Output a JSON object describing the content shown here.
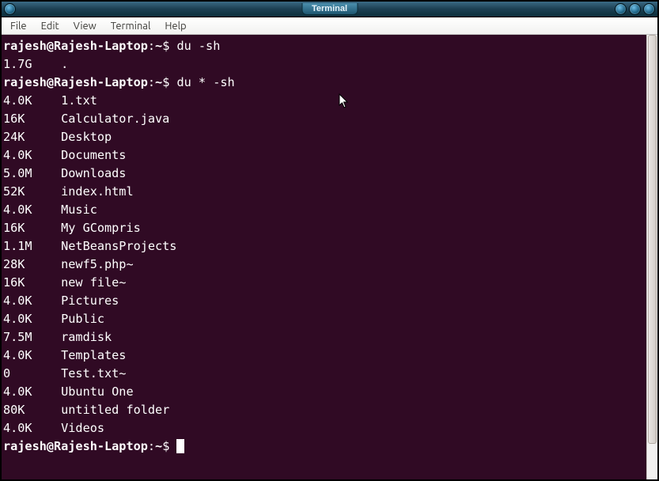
{
  "window": {
    "title": "Terminal"
  },
  "menubar": {
    "items": [
      "File",
      "Edit",
      "View",
      "Terminal",
      "Help"
    ]
  },
  "prompt": {
    "user": "rajesh",
    "host": "Rajesh-Laptop",
    "path": "~",
    "sep": ":",
    "end": "$"
  },
  "session": {
    "command1": "du -sh",
    "out1_size": "1.7G",
    "out1_name": ".",
    "command2": "du * -sh",
    "entries": [
      {
        "size": "4.0K",
        "name": "1.txt"
      },
      {
        "size": "16K",
        "name": "Calculator.java"
      },
      {
        "size": "24K",
        "name": "Desktop"
      },
      {
        "size": "4.0K",
        "name": "Documents"
      },
      {
        "size": "5.0M",
        "name": "Downloads"
      },
      {
        "size": "52K",
        "name": "index.html"
      },
      {
        "size": "4.0K",
        "name": "Music"
      },
      {
        "size": "16K",
        "name": "My GCompris"
      },
      {
        "size": "1.1M",
        "name": "NetBeansProjects"
      },
      {
        "size": "28K",
        "name": "newf5.php~"
      },
      {
        "size": "16K",
        "name": "new file~"
      },
      {
        "size": "4.0K",
        "name": "Pictures"
      },
      {
        "size": "4.0K",
        "name": "Public"
      },
      {
        "size": "7.5M",
        "name": "ramdisk"
      },
      {
        "size": "4.0K",
        "name": "Templates"
      },
      {
        "size": "0",
        "name": "Test.txt~"
      },
      {
        "size": "4.0K",
        "name": "Ubuntu One"
      },
      {
        "size": "80K",
        "name": "untitled folder"
      },
      {
        "size": "4.0K",
        "name": "Videos"
      }
    ]
  }
}
